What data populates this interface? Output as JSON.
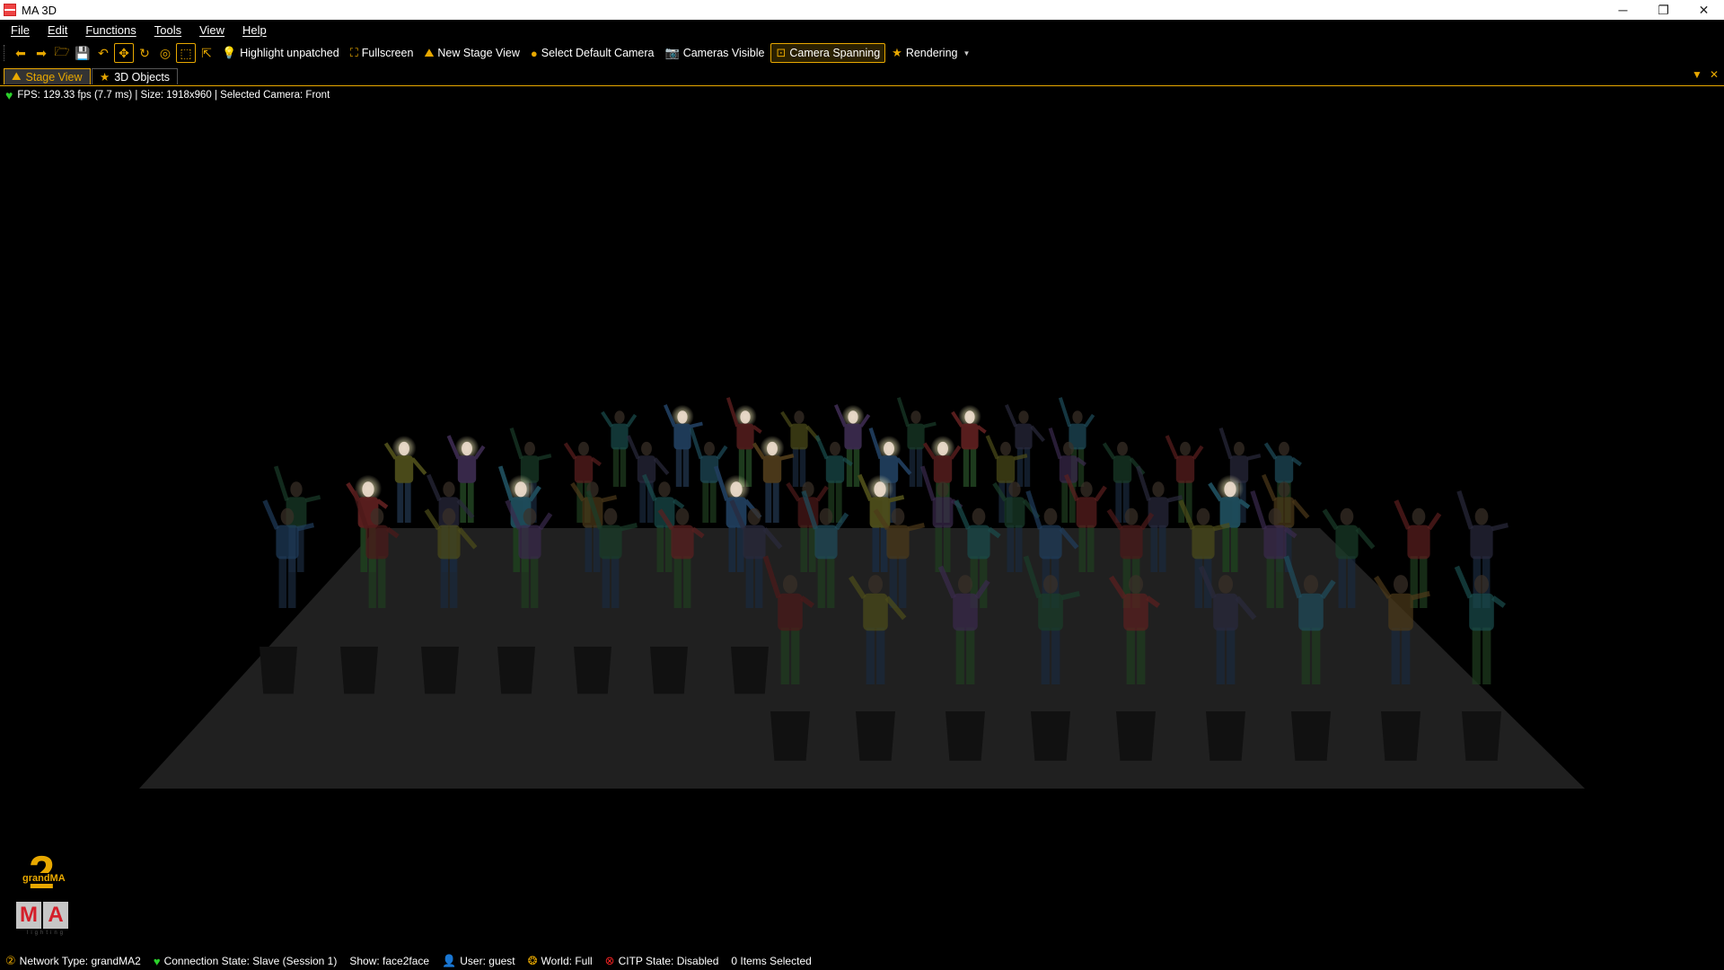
{
  "window": {
    "title": "MA 3D",
    "controls": {
      "minimize": "─",
      "restore": "❐",
      "close": "✕"
    }
  },
  "menu": {
    "items": [
      {
        "label": "File"
      },
      {
        "label": "Edit"
      },
      {
        "label": "Functions"
      },
      {
        "label": "Tools"
      },
      {
        "label": "View"
      },
      {
        "label": "Help"
      }
    ]
  },
  "toolbar": {
    "icons": [
      {
        "name": "back-icon",
        "glyph": "⬅"
      },
      {
        "name": "forward-icon",
        "glyph": "➡"
      },
      {
        "name": "open-folder-icon",
        "glyph": "🗁"
      },
      {
        "name": "save-icon",
        "glyph": "💾"
      },
      {
        "name": "undo-icon",
        "glyph": "↶"
      },
      {
        "name": "move-icon",
        "glyph": "✥",
        "active": true
      },
      {
        "name": "rotate-icon",
        "glyph": "↻"
      },
      {
        "name": "target-icon",
        "glyph": "◎"
      },
      {
        "name": "select-box-icon",
        "glyph": "⬚",
        "active": true
      },
      {
        "name": "export-icon",
        "glyph": "⇱"
      }
    ],
    "buttons": [
      {
        "name": "highlight-unpatched-button",
        "icon": "💡",
        "label": "Highlight unpatched"
      },
      {
        "name": "fullscreen-button",
        "icon": "⛶",
        "label": "Fullscreen"
      },
      {
        "name": "new-stage-view-button",
        "icon": "⛰",
        "label": "New Stage View"
      },
      {
        "name": "select-default-camera-button",
        "icon": "●",
        "label": "Select Default Camera"
      },
      {
        "name": "cameras-visible-button",
        "icon": "📷",
        "label": "Cameras Visible"
      },
      {
        "name": "camera-spanning-button",
        "icon": "⊡",
        "label": "Camera Spanning",
        "active": true
      },
      {
        "name": "rendering-button",
        "icon": "★",
        "label": "Rendering",
        "dropdown": "▼"
      }
    ]
  },
  "tabs": [
    {
      "label": "Stage View",
      "icon": "⛰",
      "selected": true
    },
    {
      "label": "3D Objects",
      "icon": "★",
      "selected": false
    }
  ],
  "tab_controls": {
    "dropdown": "▼",
    "close": "✕"
  },
  "status_line": "FPS: 129.33 fps (7.7 ms) | Size: 1918x960 | Selected Camera: Front",
  "logo": {
    "number": "2",
    "brand": "grandMA",
    "letters": [
      "M",
      "A"
    ],
    "tagline": "lighting"
  },
  "statusbar": {
    "network": "Network Type: grandMA2",
    "connection": "Connection State: Slave (Session 1)",
    "show": "Show: face2face",
    "user": "User: guest",
    "world": "World: Full",
    "citp": "CITP State: Disabled",
    "selected": "0 Items Selected"
  },
  "colors": {
    "accent": "#e8a800",
    "background": "#000000",
    "ok": "#2bd12b",
    "error": "#ee2222"
  }
}
